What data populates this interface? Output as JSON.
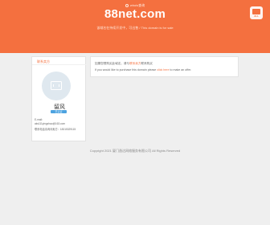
{
  "header": {
    "whois_label": "whois查询",
    "title": "88net.com",
    "subtitle": "该域名在持续开发中，可出售 / This domain is for sale",
    "logo_text": "ALL"
  },
  "seller": {
    "section_title": "联系卖方",
    "name": "留风",
    "badge": "已认证",
    "email_label": "E-mail：",
    "email": "aks111yingzhao@163.com",
    "phone": "联系电话请询问卖方：18315329115"
  },
  "notice": {
    "line1_before": "如果您想购买此域名，请与",
    "line1_link": "联系卖方",
    "line1_after": "联系购买",
    "line2_before": "If you would like to purchase this domain please ",
    "line2_link": "click here",
    "line2_after": " to make an offer."
  },
  "footer": {
    "copyright": "Copyright  2021 厦门逸达网络服务有限公司 All Rights Reserved"
  },
  "colors": {
    "accent": "#f4703f",
    "background": "#efefef",
    "badge": "#4da3e0"
  },
  "icons": [
    "globe-icon",
    "image-placeholder-icon"
  ]
}
